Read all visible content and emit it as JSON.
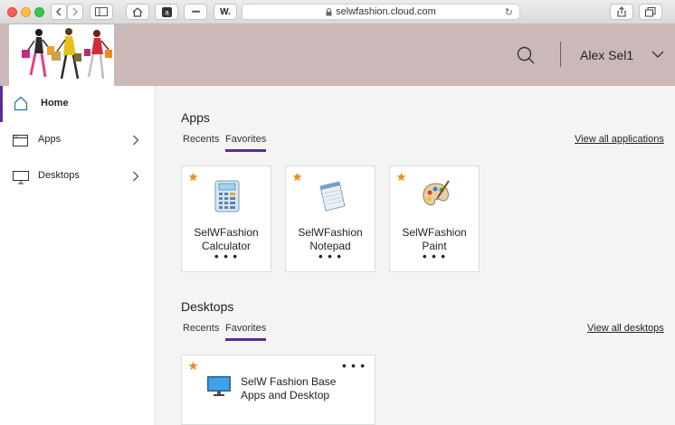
{
  "browser": {
    "address": "selwfashion.cloud.com",
    "reader_button": "W."
  },
  "header": {
    "user_name": "Alex Sel1"
  },
  "sidebar": {
    "items": [
      {
        "label": "Home"
      },
      {
        "label": "Apps"
      },
      {
        "label": "Desktops"
      }
    ]
  },
  "apps": {
    "title": "Apps",
    "tabs": [
      "Recents",
      "Favorites"
    ],
    "view_all": "View all applications",
    "cards": [
      {
        "name_line1": "SelWFashion",
        "name_line2": "Calculator",
        "icon": "calculator-icon"
      },
      {
        "name_line1": "SelWFashion",
        "name_line2": "Notepad",
        "icon": "notepad-icon"
      },
      {
        "name_line1": "SelWFashion",
        "name_line2": "Paint",
        "icon": "paint-palette-icon"
      }
    ],
    "more": "• • •"
  },
  "desktops": {
    "title": "Desktops",
    "tabs": [
      "Recents",
      "Favorites"
    ],
    "view_all": "View all desktops",
    "cards": [
      {
        "name_line1": "SelW Fashion Base",
        "name_line2": "Apps and Desktop",
        "icon": "monitor-icon"
      }
    ],
    "more": "• • •"
  },
  "colors": {
    "accent": "#5c2d91",
    "header_bg": "#cbb9ba",
    "star": "#f08a1c"
  }
}
